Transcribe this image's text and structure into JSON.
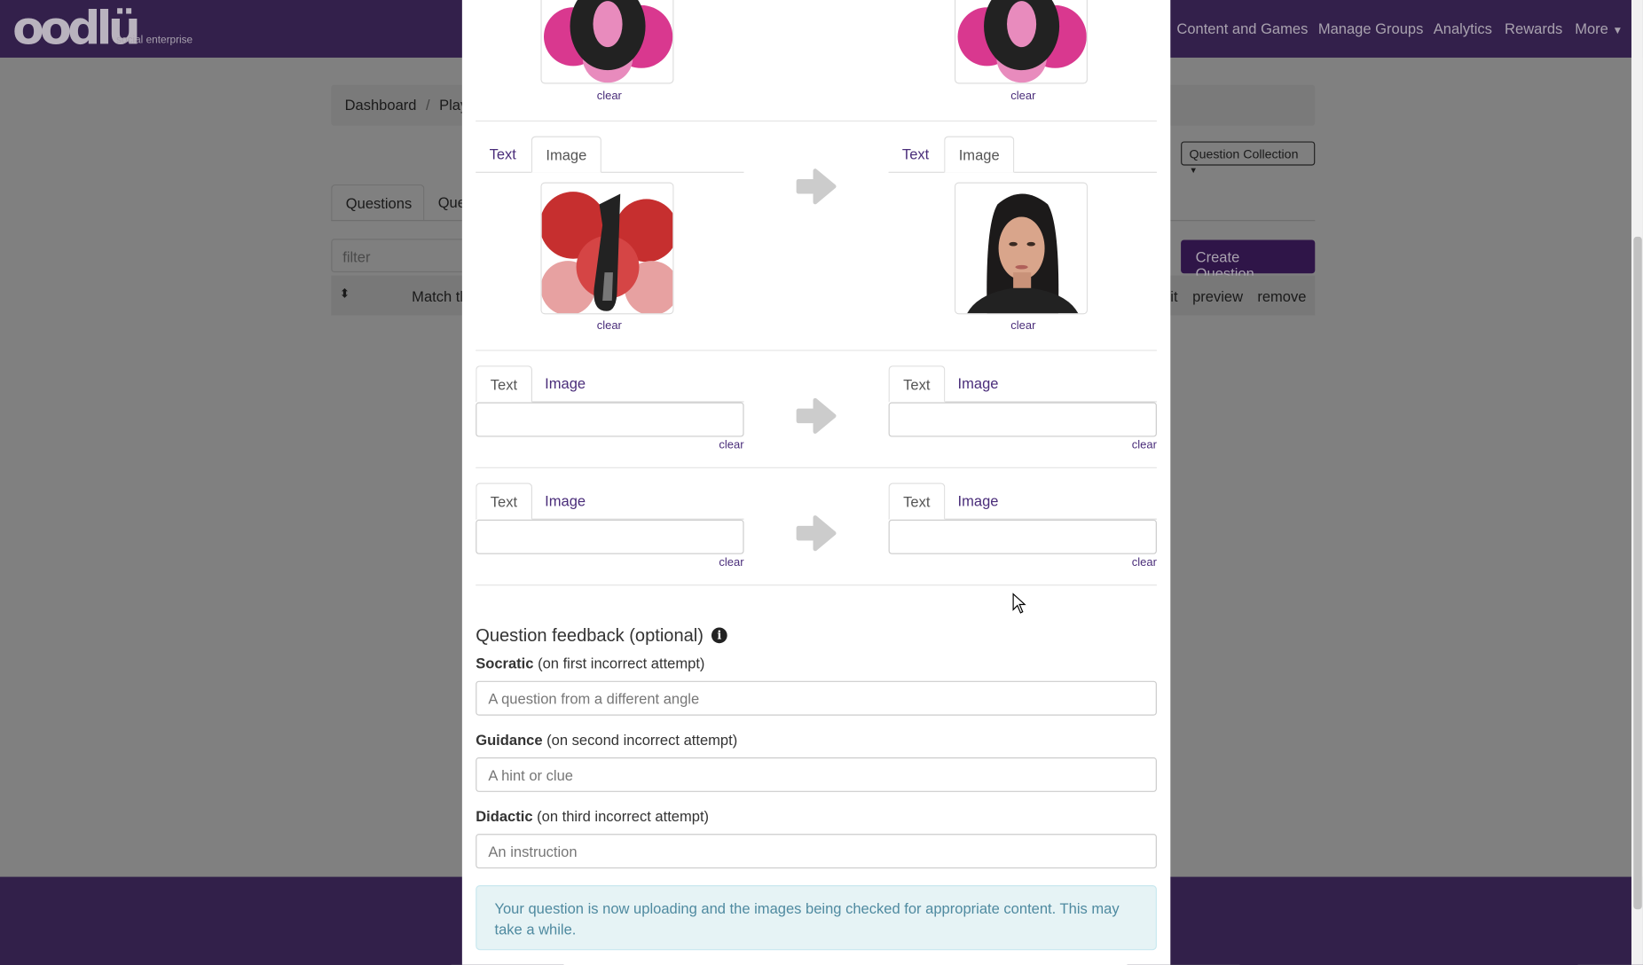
{
  "navbar": {
    "logo": "oodlü",
    "logo_tagline": "social enterprise",
    "links": [
      "Content and Games",
      "Manage Groups",
      "Analytics",
      "Rewards",
      "More"
    ],
    "more_icon": "caret-down-icon"
  },
  "breadcrumb": [
    "Dashboard",
    "/",
    "Play"
  ],
  "collection_button": "Question Collection",
  "tabs": [
    "Questions",
    "Que"
  ],
  "filter_placeholder": "filter",
  "create_button": "Create Question",
  "question_row": {
    "title": "Match th",
    "actions": [
      "it",
      "preview",
      "remove"
    ]
  },
  "modal": {
    "pairs": [
      {
        "left": {
          "mode": "Image",
          "image": "pink-number-0-image",
          "clear": "clear"
        },
        "right": {
          "mode": "Image",
          "image": "pink-number-0-image",
          "clear": "clear"
        }
      },
      {
        "left": {
          "tabs": [
            "Text",
            "Image"
          ],
          "mode": "Image",
          "image": "red-number-1-image",
          "clear": "clear"
        },
        "right": {
          "tabs": [
            "Text",
            "Image"
          ],
          "mode": "Image",
          "image": "woman-portrait-image",
          "clear": "clear"
        }
      },
      {
        "left": {
          "tabs": [
            "Text",
            "Image"
          ],
          "mode": "Text",
          "value": "",
          "clear": "clear"
        },
        "right": {
          "tabs": [
            "Text",
            "Image"
          ],
          "mode": "Text",
          "value": "",
          "clear": "clear"
        }
      },
      {
        "left": {
          "tabs": [
            "Text",
            "Image"
          ],
          "mode": "Text",
          "value": "",
          "clear": "clear"
        },
        "right": {
          "tabs": [
            "Text",
            "Image"
          ],
          "mode": "Text",
          "value": "",
          "clear": "clear"
        }
      }
    ],
    "arrow_icon": "arrow-right-icon",
    "feedback_title": "Question feedback (optional)",
    "info_icon": "info-circle-icon",
    "socratic": {
      "label": "Socratic",
      "hint": "(on first incorrect attempt)",
      "placeholder": "A question from a different angle"
    },
    "guidance": {
      "label": "Guidance",
      "hint": "(on second incorrect attempt)",
      "placeholder": "A hint or clue"
    },
    "didactic": {
      "label": "Didactic",
      "hint": "(on third incorrect attempt)",
      "placeholder": "An instruction"
    },
    "alert": "Your question is now uploading and the images being checked for appropriate content. This may take a while."
  },
  "colors": {
    "navbar": "#33204b",
    "accent": "#4a2d7a",
    "alert_bg": "#e6f3f5",
    "alert_text": "#4f8aa0"
  }
}
